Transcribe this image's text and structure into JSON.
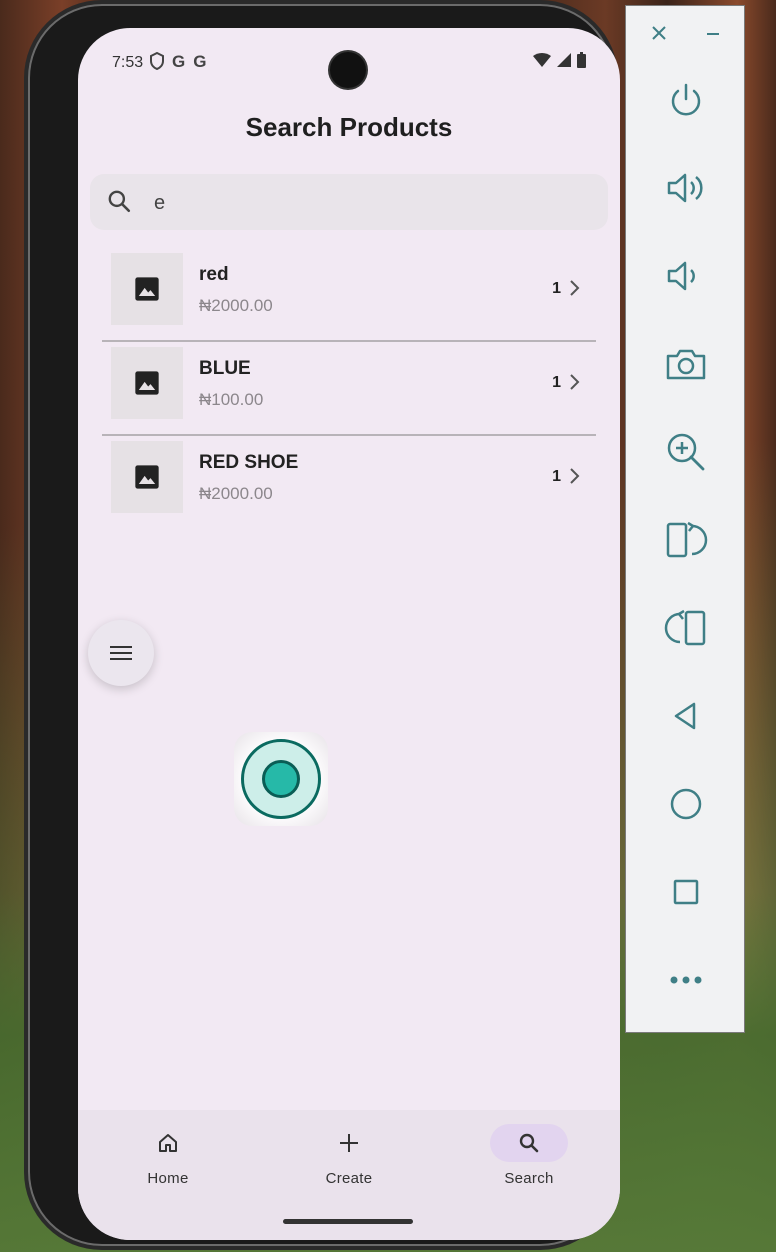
{
  "status": {
    "time": "7:53",
    "left_icons": [
      "G",
      "G"
    ]
  },
  "page": {
    "title": "Search Products"
  },
  "search": {
    "value": "e",
    "placeholder": ""
  },
  "products": [
    {
      "name": "red",
      "price": "₦2000.00",
      "qty": "1"
    },
    {
      "name": "BLUE",
      "price": "₦100.00",
      "qty": "1"
    },
    {
      "name": "RED SHOE",
      "price": "₦2000.00",
      "qty": "1"
    }
  ],
  "nav": {
    "items": [
      {
        "label": "Home",
        "icon": "home-icon",
        "active": false
      },
      {
        "label": "Create",
        "icon": "plus-icon",
        "active": false
      },
      {
        "label": "Search",
        "icon": "search-icon",
        "active": true
      }
    ]
  },
  "emulator_panel": {
    "buttons": [
      "power",
      "volume-up",
      "volume-down",
      "screenshot",
      "zoom",
      "rotate-left",
      "rotate-right",
      "back",
      "home",
      "overview",
      "more"
    ]
  },
  "colors": {
    "accent": "#e2d4ef",
    "panel_icon": "#3f7f86",
    "screen_bg": "#f2e9f3"
  }
}
